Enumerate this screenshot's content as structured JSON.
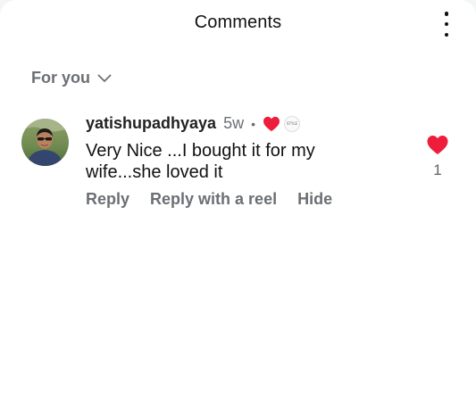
{
  "header": {
    "title": "Comments",
    "menu_icon": "more-vertical-icon"
  },
  "filter": {
    "label": "For you",
    "icon": "chevron-down-icon"
  },
  "comment": {
    "username": "yatishupadhyaya",
    "time": "5w",
    "separator": "•",
    "creator_liked_icon": "heart-icon",
    "creator_badge_text": "STYLE",
    "text": "Very Nice ...I bought it for my wife...she loved it",
    "actions": {
      "reply": "Reply",
      "reply_with_reel": "Reply with a reel",
      "hide": "Hide"
    },
    "like": {
      "icon": "heart-filled-icon",
      "count": "1",
      "liked": true
    }
  },
  "colors": {
    "background": "#ffffff",
    "muted_text": "#6b6f74",
    "heart": "#ed1d3b"
  }
}
